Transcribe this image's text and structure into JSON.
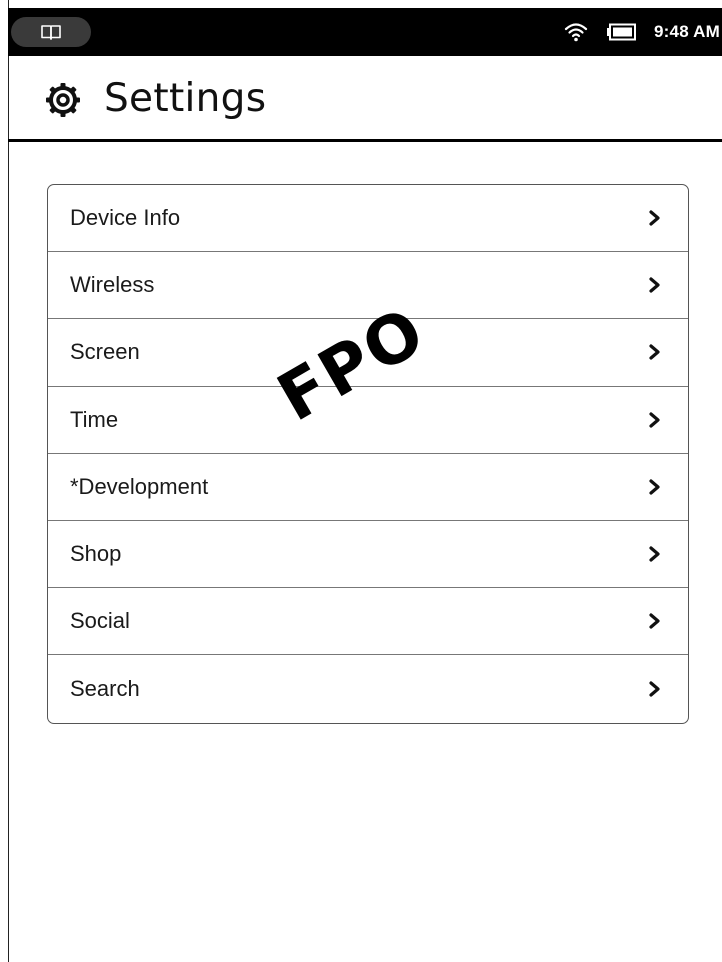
{
  "status_bar": {
    "time": "9:48 AM",
    "library_icon": "open-book-icon",
    "wifi_icon": "wifi-icon",
    "battery_icon": "battery-icon"
  },
  "header": {
    "title": "Settings",
    "icon": "gear-icon"
  },
  "menu": {
    "items": [
      {
        "label": "Device Info",
        "icon": "chevron-right-icon"
      },
      {
        "label": "Wireless",
        "icon": "chevron-right-icon"
      },
      {
        "label": "Screen",
        "icon": "chevron-right-icon"
      },
      {
        "label": "Time",
        "icon": "chevron-right-icon"
      },
      {
        "label": "*Development",
        "icon": "chevron-right-icon"
      },
      {
        "label": "Shop",
        "icon": "chevron-right-icon"
      },
      {
        "label": "Social",
        "icon": "chevron-right-icon"
      },
      {
        "label": "Search",
        "icon": "chevron-right-icon"
      }
    ]
  },
  "watermark": {
    "text": "FPO"
  },
  "colors": {
    "status_bar_bg": "#000000",
    "text": "#111111",
    "border": "#555555"
  }
}
